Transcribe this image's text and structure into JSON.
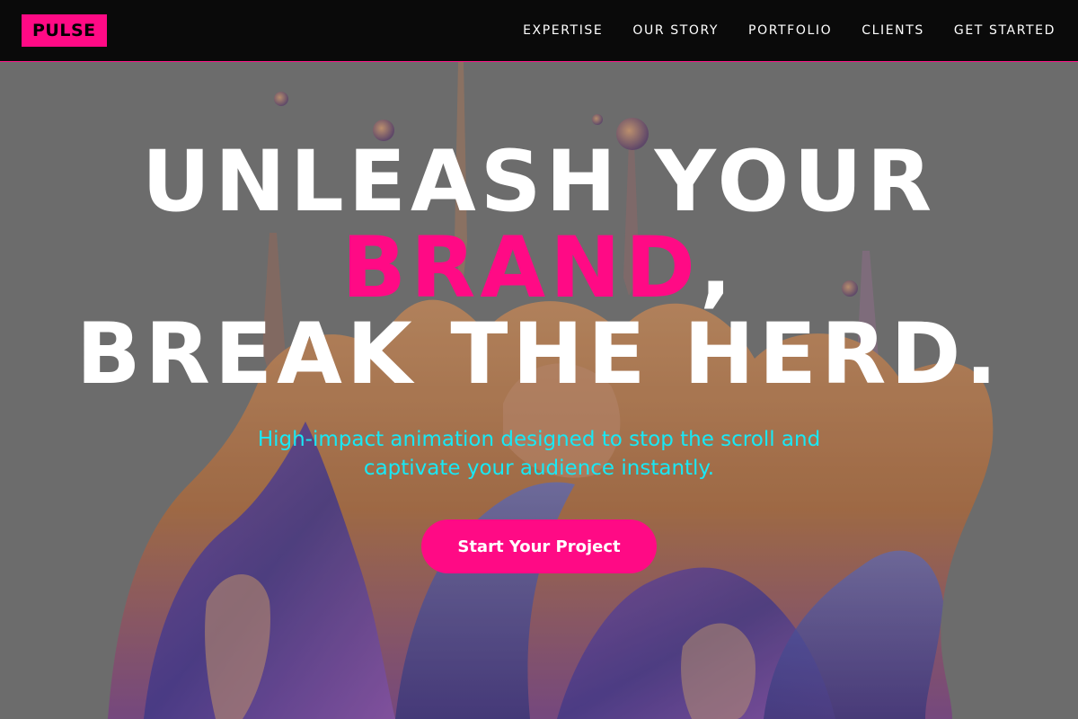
{
  "brand": {
    "logo_text": "PULSE",
    "accent_color": "#ff0a85",
    "subtitle_color": "#19e8f5"
  },
  "nav": {
    "links": [
      {
        "label": "EXPERTISE"
      },
      {
        "label": "OUR STORY"
      },
      {
        "label": "PORTFOLIO"
      },
      {
        "label": "CLIENTS"
      },
      {
        "label": "GET STARTED"
      }
    ]
  },
  "hero": {
    "headline_line1": "UNLEASH YOUR",
    "headline_accent": "BRAND",
    "headline_comma": ",",
    "headline_line3": "BREAK THE HERD.",
    "subtitle": "High-impact animation designed to stop the scroll and captivate your audience instantly.",
    "cta_label": "Start Your Project",
    "background_image": "abstract-liquid-splash"
  }
}
